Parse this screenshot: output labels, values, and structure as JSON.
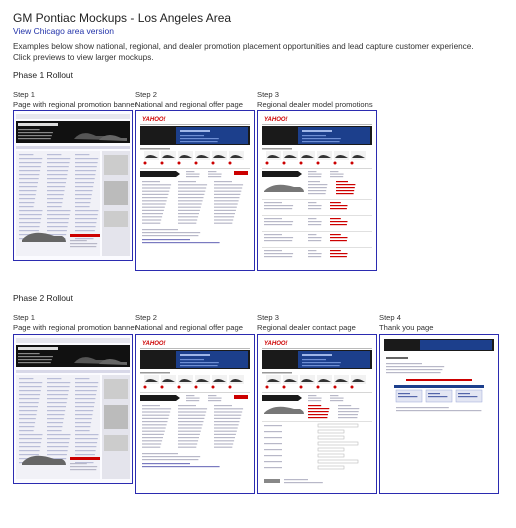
{
  "page": {
    "title": "GM Pontiac Mockups - Los Angeles Area",
    "alt_city_link": "View Chicago area version",
    "intro_line1": "Examples below show national, regional, and dealer promotion placement opportunities and lead capture customer experience.",
    "intro_line2": "Click previews to view larger mockups."
  },
  "phases": [
    {
      "title": "Phase 1 Rollout",
      "steps": [
        {
          "step": "Step 1",
          "caption": "Page with regional promotion banner",
          "kind": "banner"
        },
        {
          "step": "Step 2",
          "caption": "National and regional offer page",
          "kind": "offer"
        },
        {
          "step": "Step 3",
          "caption": "Regional dealer model promotions",
          "kind": "models"
        }
      ]
    },
    {
      "title": "Phase 2 Rollout",
      "steps": [
        {
          "step": "Step 1",
          "caption": "Page with regional promotion banner",
          "kind": "banner"
        },
        {
          "step": "Step 2",
          "caption": "National and regional offer page",
          "kind": "offer"
        },
        {
          "step": "Step 3",
          "caption": "Regional dealer contact page",
          "kind": "contact"
        },
        {
          "step": "Step 4",
          "caption": "Thank you page",
          "kind": "thanks"
        }
      ]
    }
  ],
  "colors": {
    "link": "#2233aa",
    "thumb_border": "#2b2bb0",
    "brand_red": "#cc0000",
    "banner_dark": "#1a1a1a",
    "offer_blue": "#1c3f8c"
  }
}
